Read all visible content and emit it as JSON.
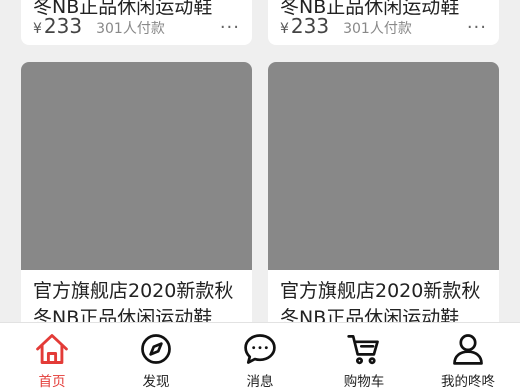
{
  "products_top": [
    {
      "title": "冬NB正品休闲运动鞋",
      "currency": "¥",
      "price": "233",
      "buyers": "301人付款",
      "more": "···"
    },
    {
      "title": "冬NB正品休闲运动鞋",
      "currency": "¥",
      "price": "233",
      "buyers": "301人付款",
      "more": "···"
    }
  ],
  "products_bottom": [
    {
      "title": "官方旗舰店2020新款秋冬NB正品休闲运动鞋"
    },
    {
      "title": "官方旗舰店2020新款秋冬NB正品休闲运动鞋"
    }
  ],
  "colors": {
    "accent": "#e33b37",
    "icon": "#111111",
    "image_placeholder": "#888888"
  },
  "tabs": [
    {
      "label": "首页",
      "icon": "home-icon",
      "active": true
    },
    {
      "label": "发现",
      "icon": "compass-icon",
      "active": false
    },
    {
      "label": "消息",
      "icon": "chat-bubble-icon",
      "active": false
    },
    {
      "label": "购物车",
      "icon": "cart-icon",
      "active": false
    },
    {
      "label": "我的咚咚",
      "icon": "user-icon",
      "active": false
    }
  ]
}
